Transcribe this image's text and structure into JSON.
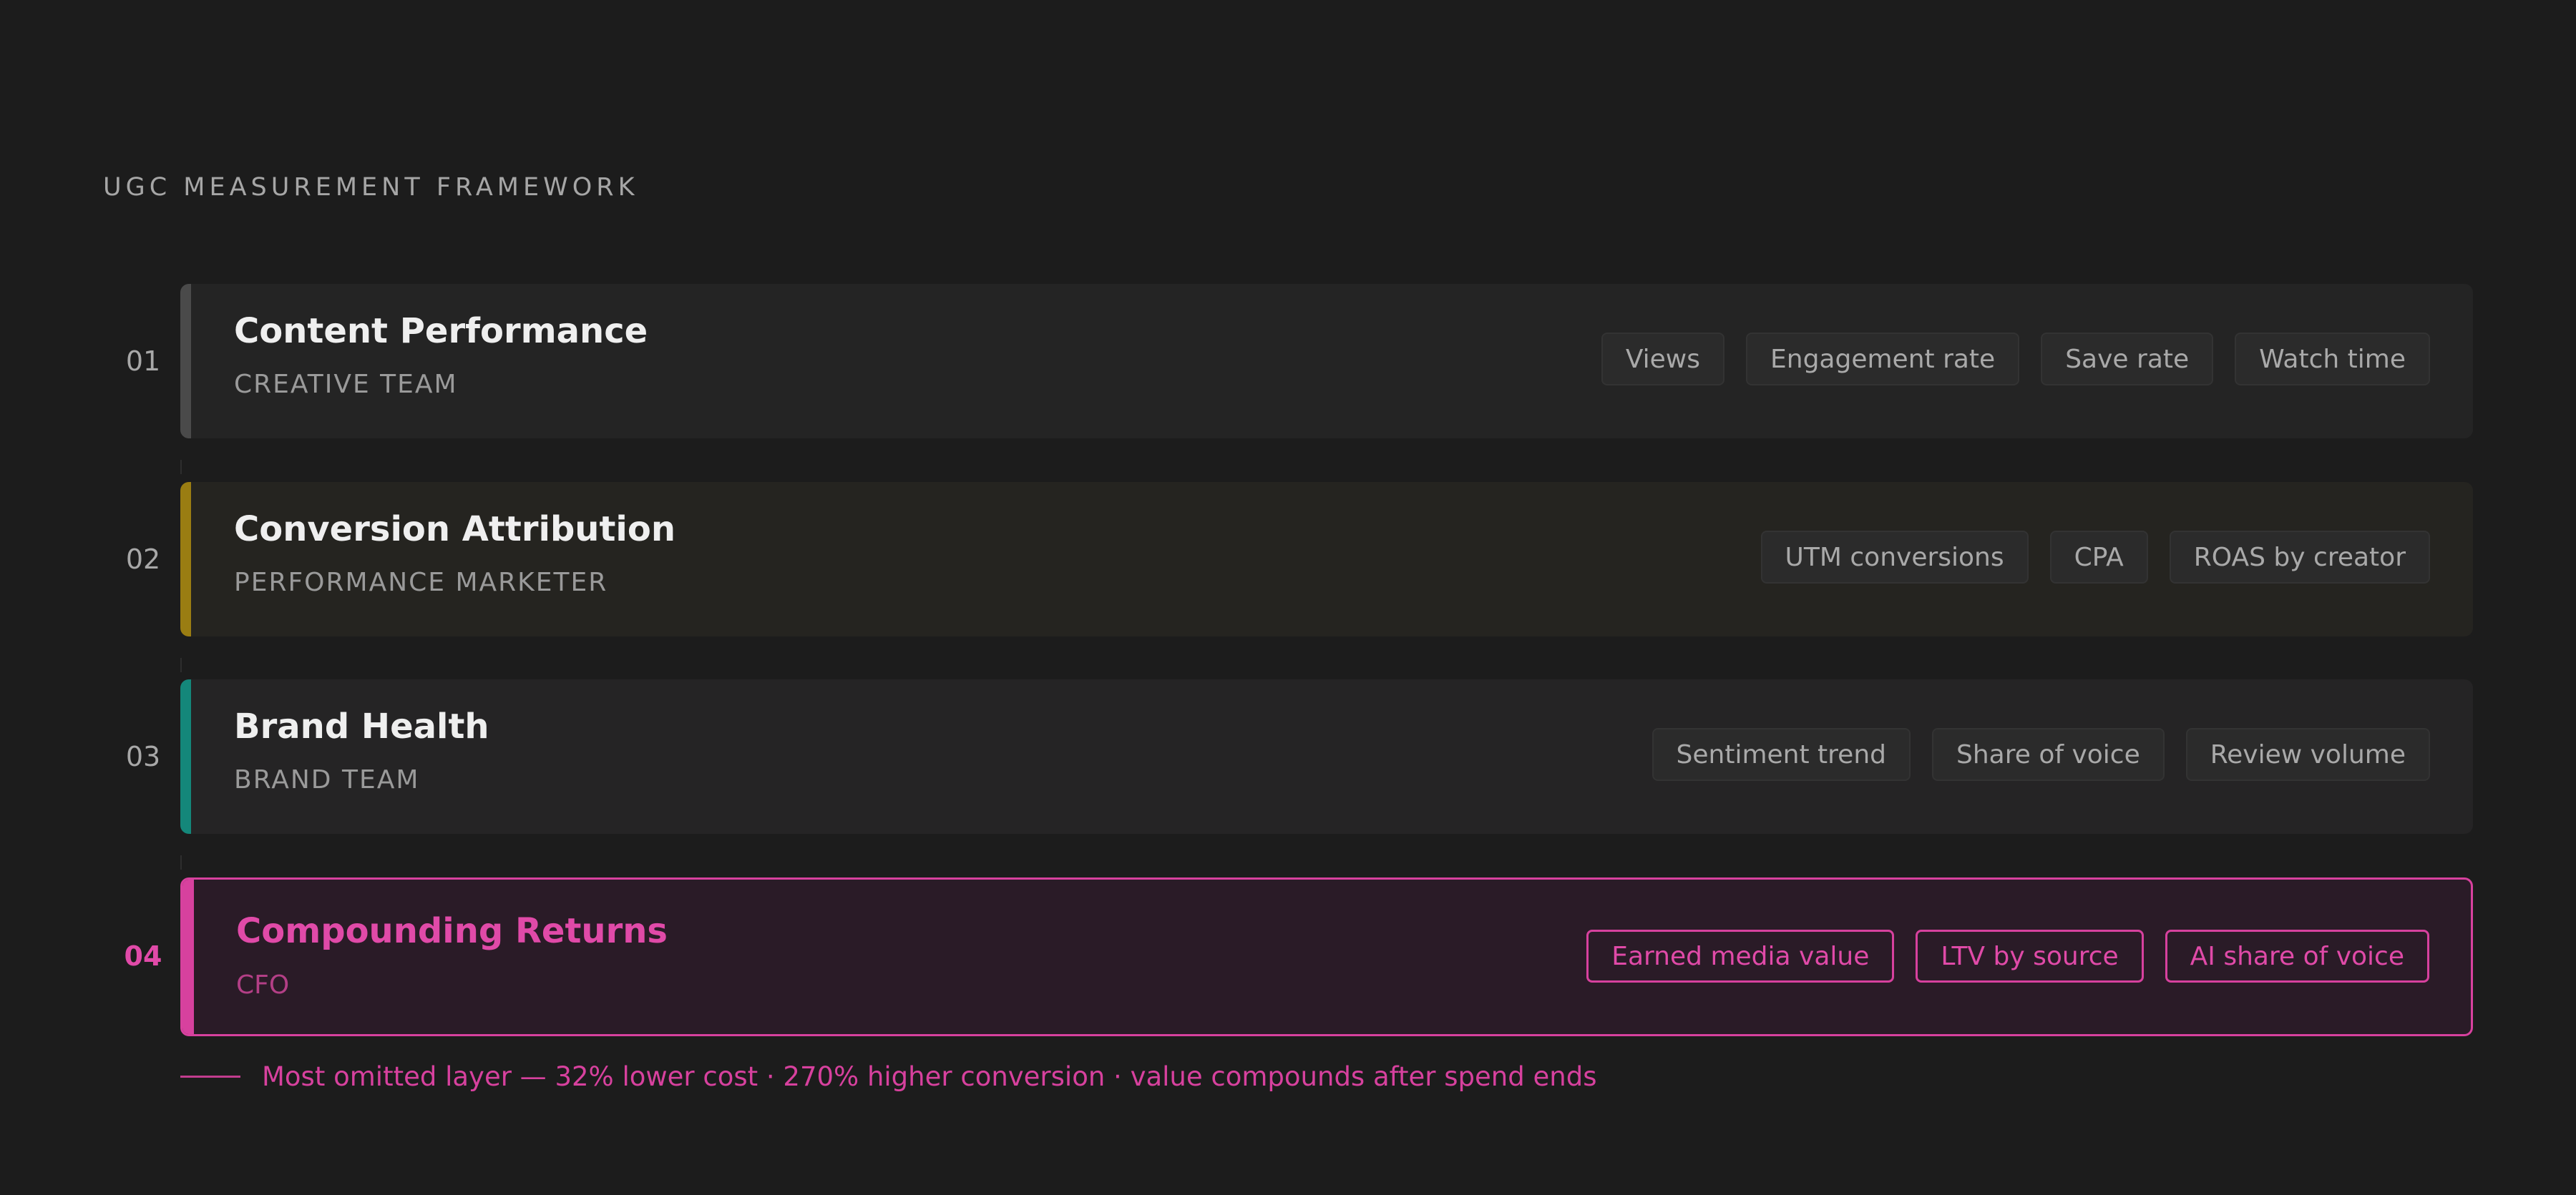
{
  "header": {
    "title": "UGC MEASUREMENT FRAMEWORK"
  },
  "colors": {
    "background": "#1c1c1c",
    "layer1_accent": "#4a4a4a",
    "layer2_accent": "#9a7d12",
    "layer3_accent": "#14877a",
    "layer4_accent": "#d7419e"
  },
  "layers": [
    {
      "number": "01",
      "title": "Content Performance",
      "owner": "CREATIVE TEAM",
      "metrics": [
        "Views",
        "Engagement rate",
        "Save rate",
        "Watch time"
      ]
    },
    {
      "number": "02",
      "title": "Conversion Attribution",
      "owner": "PERFORMANCE MARKETER",
      "metrics": [
        "UTM conversions",
        "CPA",
        "ROAS by creator"
      ]
    },
    {
      "number": "03",
      "title": "Brand Health",
      "owner": "BRAND TEAM",
      "metrics": [
        "Sentiment trend",
        "Share of voice",
        "Review volume"
      ]
    },
    {
      "number": "04",
      "title": "Compounding Returns",
      "owner": "CFO",
      "metrics": [
        "Earned media value",
        "LTV by source",
        "AI share of voice"
      ]
    }
  ],
  "footnote": {
    "text": "Most omitted layer — 32% lower cost · 270% higher conversion · value compounds after spend ends"
  }
}
